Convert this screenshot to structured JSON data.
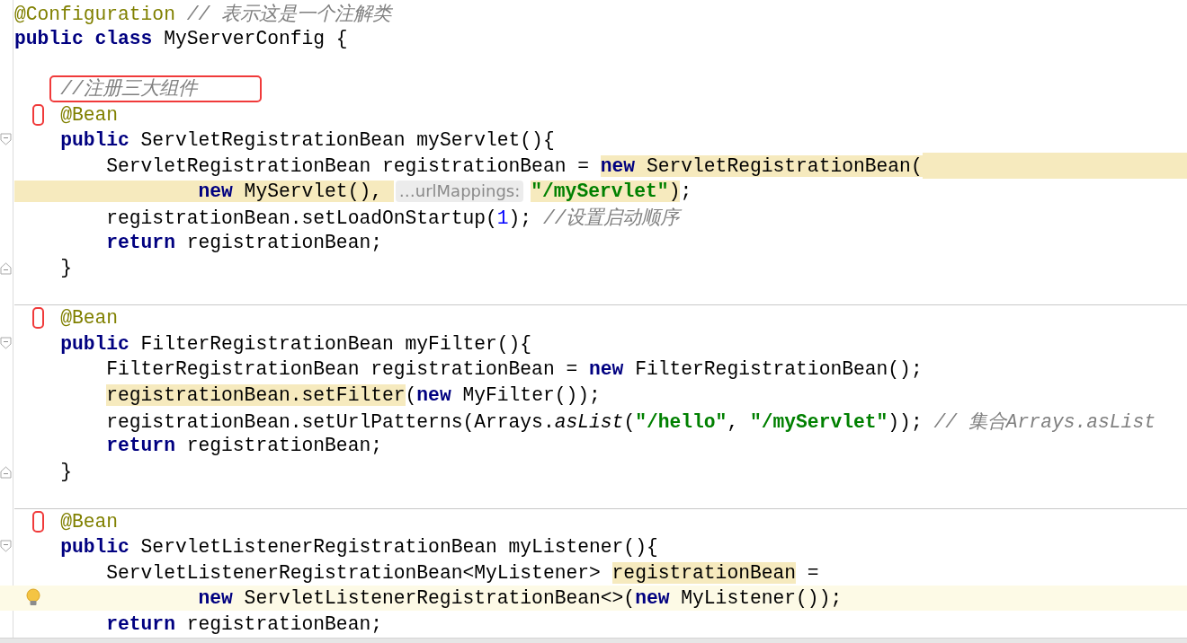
{
  "editor": {
    "blocks": [
      {
        "lines": [
          {
            "parts": [
              {
                "kind": "code",
                "tokens": [
                  {
                    "kind": "annotation",
                    "text": "@Configuration"
                  },
                  {
                    "kind": "comment",
                    "text": " // 表示这是一个注解类"
                  }
                ]
              }
            ]
          },
          {
            "parts": [
              {
                "kind": "code",
                "tokens": [
                  {
                    "kind": "keyword",
                    "text": "public class"
                  },
                  {
                    "kind": "plain",
                    "text": " MyServerConfig {"
                  }
                ]
              }
            ]
          }
        ]
      },
      {
        "lines": [
          {
            "parts": [
              {
                "kind": "code",
                "boxed": true,
                "tokens": [
                  {
                    "kind": "comment",
                    "text": "    //注册三大组件"
                  }
                ]
              }
            ]
          },
          {
            "gutter_mark": true,
            "parts": [
              {
                "kind": "code",
                "tokens": [
                  {
                    "kind": "annotation",
                    "text": "    @Bean"
                  }
                ]
              }
            ]
          },
          {
            "fold_start": true,
            "parts": [
              {
                "kind": "code",
                "tokens": [
                  {
                    "kind": "keyword",
                    "text": "    public"
                  },
                  {
                    "kind": "plain",
                    "text": " ServletRegistrationBean myServlet(){"
                  }
                ]
              }
            ]
          },
          {
            "highlight_rest": true,
            "parts": [
              {
                "kind": "code",
                "tokens": [
                  {
                    "kind": "plain",
                    "text": "        ServletRegistrationBean registrationBean = "
                  },
                  {
                    "kind": "keyword",
                    "text": "new",
                    "highlighted": true
                  },
                  {
                    "kind": "plain",
                    "text": " ServletRegistrationBean(",
                    "highlighted": true
                  }
                ]
              }
            ]
          },
          {
            "indent_highlighted": true,
            "parts": [
              {
                "kind": "code",
                "tokens": [
                  {
                    "kind": "keyword",
                    "text": "                new",
                    "highlighted": true
                  },
                  {
                    "kind": "plain",
                    "text": " MyServlet(), ",
                    "highlighted": true
                  }
                ]
              },
              {
                "kind": "hint",
                "text": "…urlMappings:"
              },
              {
                "kind": "code",
                "tokens": [
                  {
                    "kind": "string",
                    "text": "\"/myServlet\"",
                    "highlighted": true
                  },
                  {
                    "kind": "plain",
                    "text": ")",
                    "highlighted": true
                  },
                  {
                    "kind": "plain",
                    "text": ";"
                  }
                ]
              }
            ]
          },
          {
            "parts": [
              {
                "kind": "code",
                "tokens": [
                  {
                    "kind": "plain",
                    "text": "        registrationBean.setLoadOnStartup("
                  },
                  {
                    "kind": "number",
                    "text": "1"
                  },
                  {
                    "kind": "plain",
                    "text": "); "
                  },
                  {
                    "kind": "comment",
                    "text": "//设置启动顺序"
                  }
                ]
              }
            ]
          },
          {
            "parts": [
              {
                "kind": "code",
                "tokens": [
                  {
                    "kind": "keyword",
                    "text": "        return"
                  },
                  {
                    "kind": "plain",
                    "text": " registrationBean;"
                  }
                ]
              }
            ]
          },
          {
            "fold_end": true,
            "parts": [
              {
                "kind": "code",
                "tokens": [
                  {
                    "kind": "plain",
                    "text": "    }"
                  }
                ]
              }
            ]
          }
        ]
      },
      {
        "separator_above": true,
        "lines": [
          {
            "gutter_mark": true,
            "parts": [
              {
                "kind": "code",
                "tokens": [
                  {
                    "kind": "annotation",
                    "text": "    @Bean"
                  }
                ]
              }
            ]
          },
          {
            "fold_start": true,
            "parts": [
              {
                "kind": "code",
                "tokens": [
                  {
                    "kind": "keyword",
                    "text": "    public"
                  },
                  {
                    "kind": "plain",
                    "text": " FilterRegistrationBean myFilter(){"
                  }
                ]
              }
            ]
          },
          {
            "parts": [
              {
                "kind": "code",
                "tokens": [
                  {
                    "kind": "plain",
                    "text": "        FilterRegistrationBean registrationBean = "
                  },
                  {
                    "kind": "keyword",
                    "text": "new"
                  },
                  {
                    "kind": "plain",
                    "text": " FilterRegistrationBean();"
                  }
                ]
              }
            ]
          },
          {
            "parts": [
              {
                "kind": "code",
                "tokens": [
                  {
                    "kind": "plain",
                    "text": "        registrationBean.setFilter",
                    "highlighted": true
                  },
                  {
                    "kind": "plain",
                    "text": "("
                  },
                  {
                    "kind": "keyword",
                    "text": "new"
                  },
                  {
                    "kind": "plain",
                    "text": " MyFilter());"
                  }
                ]
              }
            ]
          },
          {
            "parts": [
              {
                "kind": "code",
                "tokens": [
                  {
                    "kind": "plain",
                    "text": "        registrationBean.setUrlPatterns(Arrays."
                  },
                  {
                    "kind": "static",
                    "text": "asList"
                  },
                  {
                    "kind": "plain",
                    "text": "("
                  },
                  {
                    "kind": "string",
                    "text": "\"/hello\""
                  },
                  {
                    "kind": "plain",
                    "text": ", "
                  },
                  {
                    "kind": "string",
                    "text": "\"/myServlet\""
                  },
                  {
                    "kind": "plain",
                    "text": ")); "
                  },
                  {
                    "kind": "comment",
                    "text": "// 集合Arrays.asList"
                  }
                ]
              }
            ]
          },
          {
            "parts": [
              {
                "kind": "code",
                "tokens": [
                  {
                    "kind": "keyword",
                    "text": "        return"
                  },
                  {
                    "kind": "plain",
                    "text": " registrationBean;"
                  }
                ]
              }
            ]
          },
          {
            "fold_end": true,
            "parts": [
              {
                "kind": "code",
                "tokens": [
                  {
                    "kind": "plain",
                    "text": "    }"
                  }
                ]
              }
            ]
          }
        ]
      },
      {
        "separator_above": true,
        "lines": [
          {
            "gutter_mark": true,
            "parts": [
              {
                "kind": "code",
                "tokens": [
                  {
                    "kind": "annotation",
                    "text": "    @Bean"
                  }
                ]
              }
            ]
          },
          {
            "fold_start": true,
            "parts": [
              {
                "kind": "code",
                "tokens": [
                  {
                    "kind": "keyword",
                    "text": "    public"
                  },
                  {
                    "kind": "plain",
                    "text": " ServletListenerRegistrationBean myListener(){"
                  }
                ]
              }
            ]
          },
          {
            "parts": [
              {
                "kind": "code",
                "tokens": [
                  {
                    "kind": "plain",
                    "text": "        ServletListenerRegistrationBean<MyListener> "
                  },
                  {
                    "kind": "plain",
                    "text": "registrationBean",
                    "highlighted": true
                  },
                  {
                    "kind": "plain",
                    "text": " ="
                  }
                ]
              }
            ]
          },
          {
            "current": true,
            "bulb": true,
            "parts": [
              {
                "kind": "code",
                "tokens": [
                  {
                    "kind": "keyword",
                    "text": "                new"
                  },
                  {
                    "kind": "plain",
                    "text": " ServletListenerRegistrationBean<>("
                  },
                  {
                    "kind": "keyword",
                    "text": "new"
                  },
                  {
                    "kind": "plain",
                    "text": " MyListener());"
                  }
                ]
              }
            ]
          },
          {
            "parts": [
              {
                "kind": "code",
                "tokens": [
                  {
                    "kind": "keyword",
                    "text": "        return"
                  },
                  {
                    "kind": "plain",
                    "text": " registrationBean;"
                  }
                ]
              }
            ]
          }
        ]
      }
    ]
  }
}
